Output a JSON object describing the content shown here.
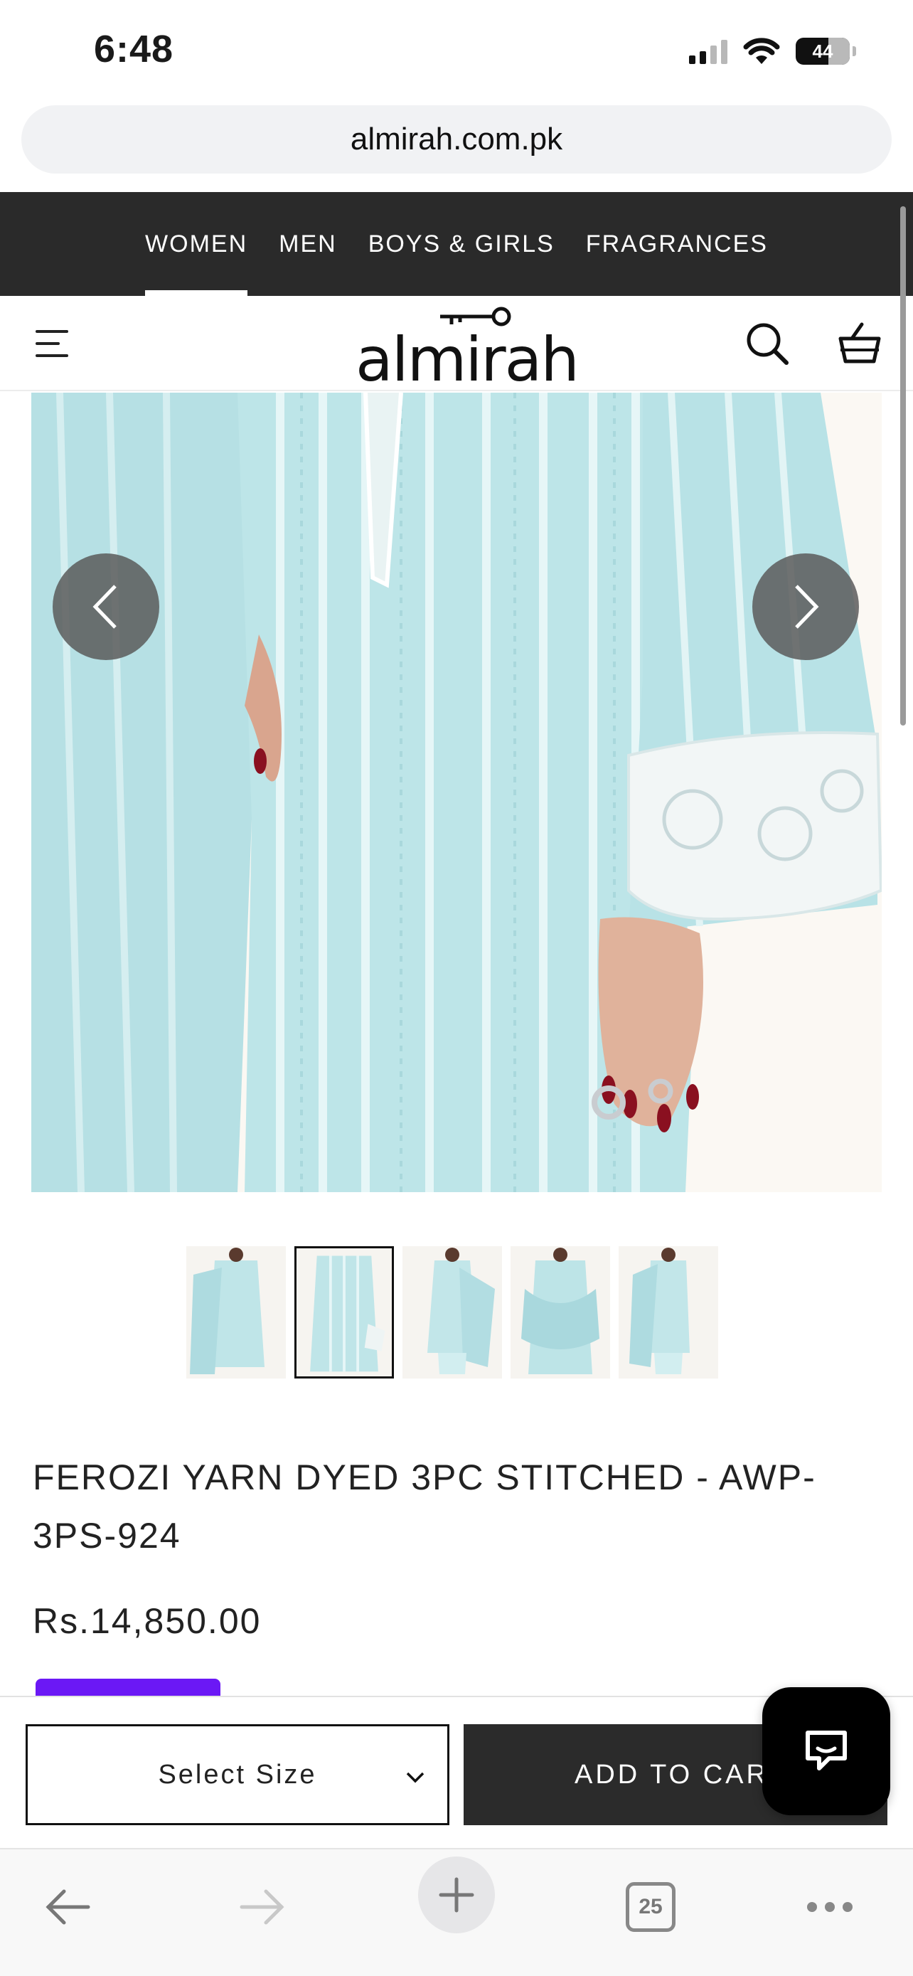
{
  "status_bar": {
    "time": "6:48",
    "battery_level": "44"
  },
  "browser": {
    "url": "almirah.com.pk",
    "tab_count": "25"
  },
  "category_nav": {
    "items": [
      {
        "label": "WOMEN",
        "active": true
      },
      {
        "label": "MEN",
        "active": false
      },
      {
        "label": "BOYS & GIRLS",
        "active": false
      },
      {
        "label": "FRAGRANCES",
        "active": false
      }
    ]
  },
  "header": {
    "logo_text": "almirah"
  },
  "gallery": {
    "thumbnail_count": 5,
    "active_thumbnail": 2
  },
  "product": {
    "title": "FEROZI YARN DYED 3PC STITCHED - AWP-3PS-924",
    "price": "Rs.14,850.00"
  },
  "sticky_bar": {
    "size_select_label": "Select Size",
    "add_to_cart_label": "ADD TO CART"
  },
  "colors": {
    "nav_bg": "#2a2a2a",
    "fabric": "#bfe6ea",
    "badge": "#6b18f5",
    "button_dark": "#2b2b2b"
  }
}
